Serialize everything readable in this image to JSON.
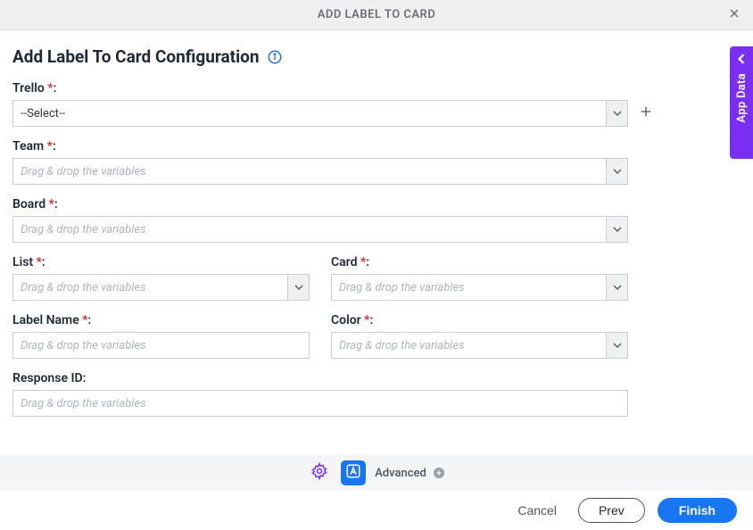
{
  "header": {
    "title": "ADD LABEL TO CARD"
  },
  "page_title": "Add Label To Card Configuration",
  "app_data_tab": "App Data",
  "fields": {
    "trello": {
      "label": "Trello",
      "value": "--Select--"
    },
    "team": {
      "label": "Team",
      "placeholder": "Drag & drop the variables"
    },
    "board": {
      "label": "Board",
      "placeholder": "Drag & drop the variables"
    },
    "list": {
      "label": "List",
      "placeholder": "Drag & drop the variables"
    },
    "card": {
      "label": "Card",
      "placeholder": "Drag & drop the variables"
    },
    "label_name": {
      "label": "Label Name",
      "placeholder": "Drag & drop the variables"
    },
    "color": {
      "label": "Color",
      "placeholder": "Drag & drop the variables"
    },
    "response_id": {
      "label": "Response ID",
      "placeholder": "Drag & drop the variables"
    }
  },
  "footer": {
    "advanced": "Advanced"
  },
  "actions": {
    "cancel": "Cancel",
    "prev": "Prev",
    "finish": "Finish"
  }
}
